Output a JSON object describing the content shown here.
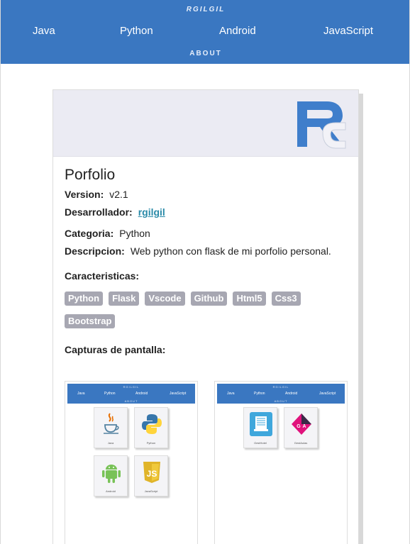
{
  "header": {
    "brand": "RGILGIL",
    "nav": [
      "Java",
      "Python",
      "Android",
      "JavaScript"
    ],
    "about": "ABOUT"
  },
  "project": {
    "title": "Porfolio",
    "version_label": "Version:",
    "version": "v2.1",
    "developer_label": "Desarrollador:",
    "developer": "rgilgil",
    "category_label": "Categoria:",
    "category": "Python",
    "description_label": "Descripcion:",
    "description": "Web python con flask de mi porfolio personal.",
    "features_label": "Caracteristicas:",
    "features": [
      "Python",
      "Flask",
      "Vscode",
      "Github",
      "Html5",
      "Css3",
      "Bootstrap"
    ],
    "screenshots_label": "Capturas de pantalla:"
  },
  "screenshots": [
    {
      "brand": "RGILGIL",
      "nav": [
        "Java",
        "Python",
        "Android",
        "JavaScript"
      ],
      "about": "ABOUT",
      "tiles": [
        "Java",
        "Python",
        "Android",
        "JavaScript"
      ]
    },
    {
      "brand": "RGILGIL",
      "nav": [
        "Java",
        "Python",
        "Android",
        "JavaScript"
      ],
      "about": "ABOUT",
      "tiles": [
        "GestHotel",
        "GestAulas"
      ]
    }
  ],
  "colors": {
    "header": "#3a77c1",
    "tag": "#a7a7b2",
    "link": "#2a8aa8"
  }
}
